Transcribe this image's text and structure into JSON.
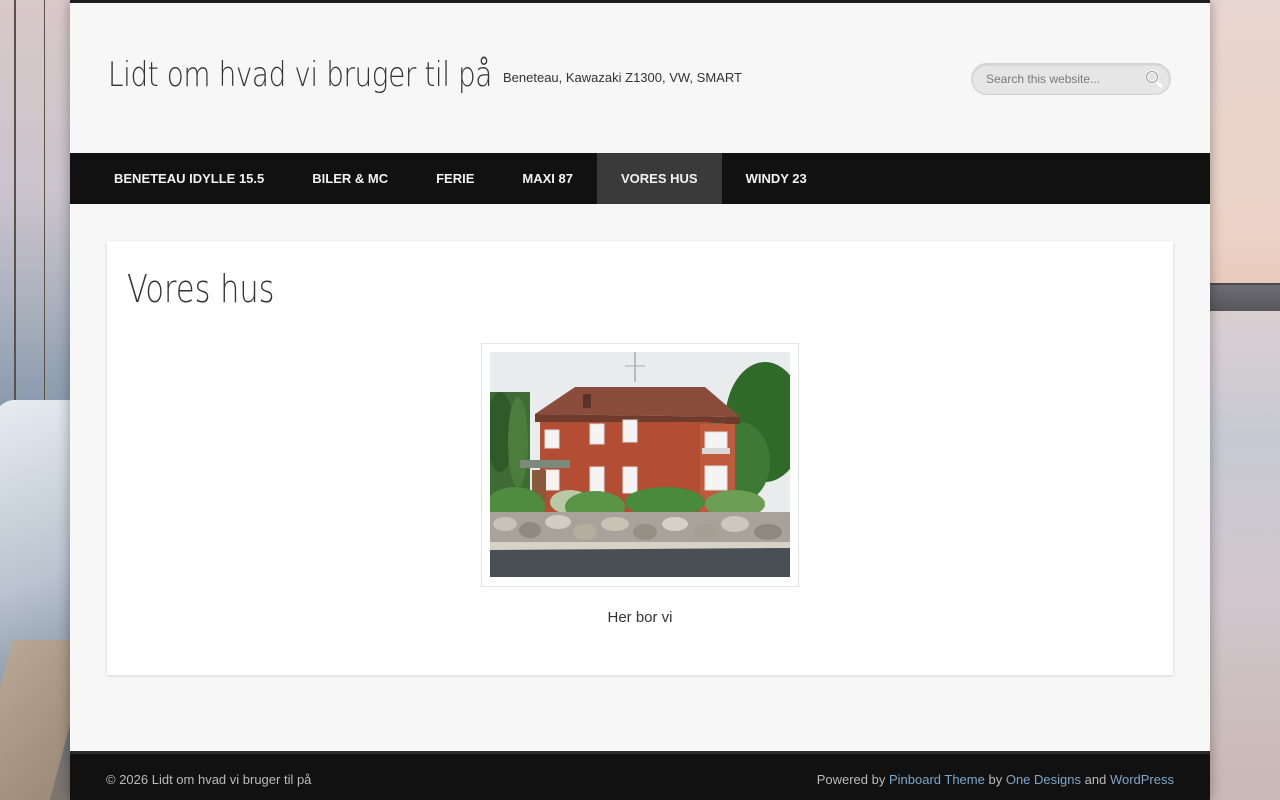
{
  "header": {
    "site_title": "Lidt om hvad vi bruger til på",
    "site_description": "Beneteau, Kawazaki Z1300, VW, SMART",
    "search_placeholder": "Search this website..."
  },
  "nav": {
    "items": [
      {
        "label": "BENETEAU IDYLLE 15.5"
      },
      {
        "label": "BILER & MC"
      },
      {
        "label": "FERIE"
      },
      {
        "label": "MAXI 87"
      },
      {
        "label": "VORES HUS",
        "active": true
      },
      {
        "label": "WINDY 23"
      }
    ]
  },
  "main": {
    "page_title": "Vores hus",
    "image_caption": "Her bor vi"
  },
  "footer": {
    "copyright": "© 2026 Lidt om hvad vi bruger til på",
    "powered_by": "Powered by",
    "theme_link": "Pinboard Theme",
    "by": "by",
    "designer_link": "One Designs",
    "and": "and",
    "platform_link": "WordPress"
  },
  "colors": {
    "nav_bg": "#111111",
    "nav_active_bg": "#3a3a3a",
    "footer_link": "#7ea7c9",
    "page_bg": "#f7f7f7"
  }
}
